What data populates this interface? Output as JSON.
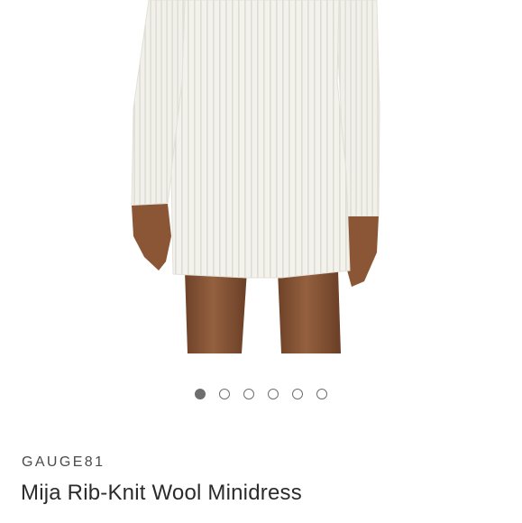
{
  "product": {
    "brand": "GAUGE81",
    "name": "Mija Rib-Knit Wool Minidress"
  },
  "gallery": {
    "image_count": 6,
    "active_index": 0,
    "image_alt": "white rib-knit wool minidress"
  },
  "colors": {
    "dress": "#f3f2ec",
    "skin": "#8a5a3c",
    "dot_active": "#6e6e6e"
  }
}
